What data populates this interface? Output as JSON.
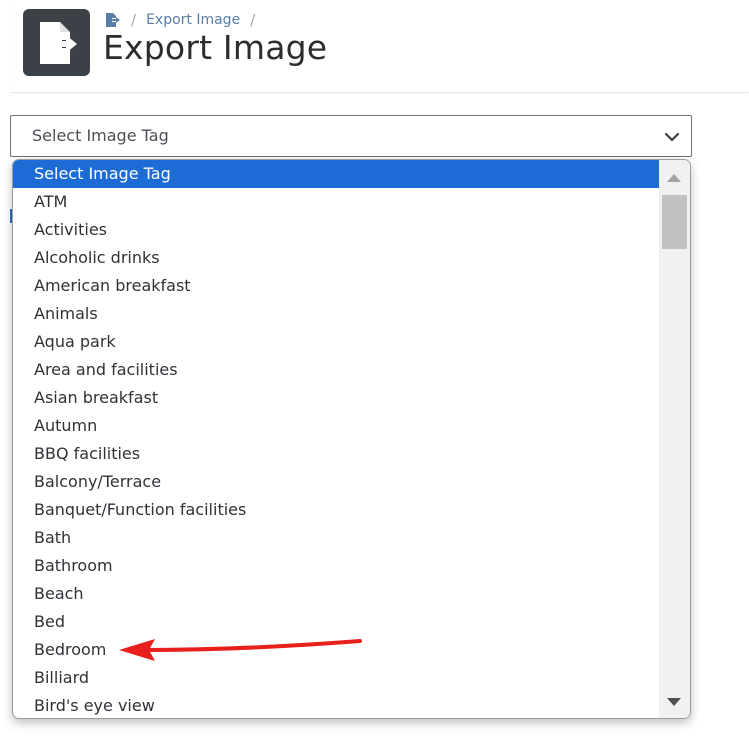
{
  "header": {
    "breadcrumb": {
      "home_icon": "export-doc-icon",
      "separator": "/",
      "current": "Export Image"
    },
    "title": "Export Image",
    "app_icon": "export-doc-icon"
  },
  "select": {
    "value": "Select Image Tag",
    "chevron_icon": "chevron-down-icon"
  },
  "dropdown": {
    "selected_index": 0,
    "options": [
      "Select Image Tag",
      "ATM",
      "Activities",
      "Alcoholic drinks",
      "American breakfast",
      "Animals",
      "Aqua park",
      "Area and facilities",
      "Asian breakfast",
      "Autumn",
      "BBQ facilities",
      "Balcony/Terrace",
      "Banquet/Function facilities",
      "Bath",
      "Bathroom",
      "Beach",
      "Bed",
      "Bedroom",
      "Billiard",
      "Bird's eye view"
    ]
  },
  "annotation": {
    "arrow_icon": "red-arrow-icon",
    "arrow_color": "#e8201c",
    "points_to": "Bedroom"
  },
  "colors": {
    "selected_bg": "#1d6cd6",
    "icon_bg": "#3c4047",
    "breadcrumb_link": "#5b7ea8"
  }
}
